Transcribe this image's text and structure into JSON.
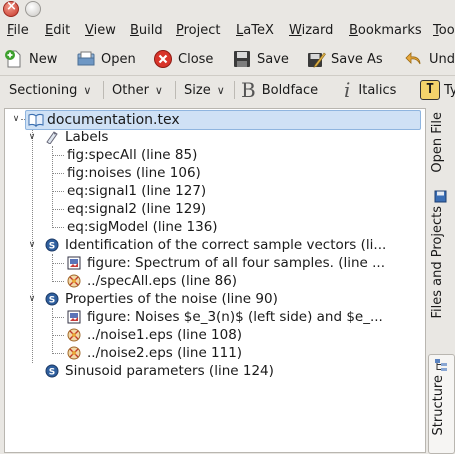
{
  "menubar": {
    "items": [
      {
        "label": "File",
        "u": "F",
        "rest": "ile"
      },
      {
        "label": "Edit",
        "u": "E",
        "rest": "dit"
      },
      {
        "label": "View",
        "u": "V",
        "rest": "iew"
      },
      {
        "label": "Build",
        "u": "B",
        "rest": "uild"
      },
      {
        "label": "Project",
        "u": "P",
        "rest": "roject"
      },
      {
        "label": "LaTeX",
        "u": "L",
        "rest": "aTeX"
      },
      {
        "label": "Wizard",
        "u": "W",
        "rest": "izard"
      },
      {
        "label": "Bookmarks",
        "u": "B",
        "rest": "ookmarks"
      },
      {
        "label": "Too",
        "u": "T",
        "rest": "oo"
      }
    ]
  },
  "toolbar1": {
    "new_label": "New",
    "open_label": "Open",
    "close_label": "Close",
    "save_label": "Save",
    "saveas_label": "Save As",
    "undo_label": "Und"
  },
  "toolbar2": {
    "sectioning_label": "Sectioning",
    "other_label": "Other",
    "size_label": "Size",
    "boldface_label": "Boldface",
    "italics_label": "Italics",
    "ty_label": "Ty"
  },
  "tree": {
    "root": "documentation.tex",
    "labels_header": "Labels",
    "labels": [
      "fig:specAll (line 85)",
      "fig:noises (line 106)",
      "eq:signal1 (line 127)",
      "eq:signal2 (line 129)",
      "eq:sigModel (line 136)"
    ],
    "sections": [
      {
        "title": "Identification of the correct sample vectors (li...",
        "children": [
          "figure: Spectrum of all four samples. (line ...",
          "../specAll.eps (line 86)"
        ]
      },
      {
        "title": "Properties of the noise (line 90)",
        "children": [
          "figure: Noises $e_3(n)$ (left side) and $e_...",
          "../noise1.eps (line 108)",
          "../noise2.eps (line 111)"
        ]
      },
      {
        "title": "Sinusoid parameters (line 124)",
        "children": []
      }
    ]
  },
  "sidebar": {
    "open_file_tab": "Open File",
    "files_projects_tab": "Files and Projects",
    "structure_tab": "Structure"
  },
  "colors": {
    "selection": "#cfe1f5",
    "background": "#e9e7e3"
  }
}
